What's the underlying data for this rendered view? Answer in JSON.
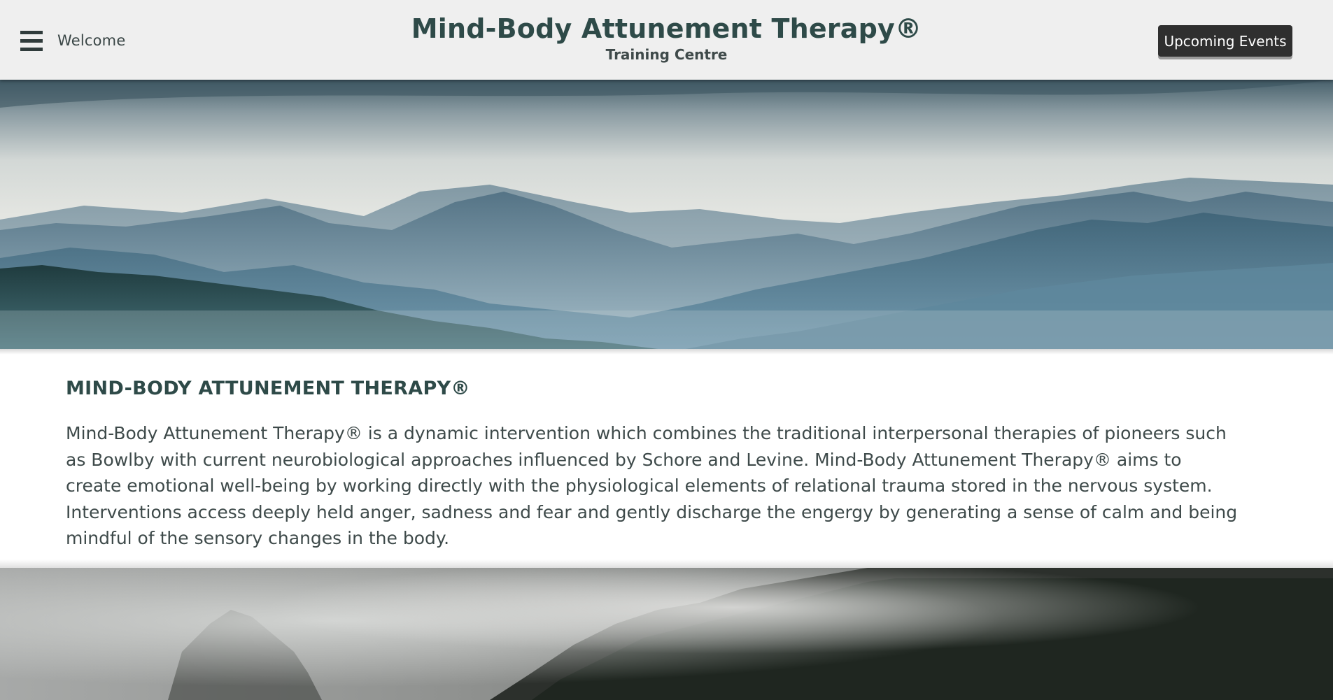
{
  "header": {
    "menu_icon": "hamburger-menu-icon",
    "welcome_label": "Welcome",
    "title": "Mind-Body Attunement Therapy®",
    "subtitle": "Training Centre",
    "events_button_label": "Upcoming Events"
  },
  "hero": {
    "image": "misty-blue-mountains-forest"
  },
  "section": {
    "heading": "MIND-BODY ATTUNEMENT THERAPY®",
    "body": "Mind-Body Attunement Therapy® is a dynamic intervention which combines the traditional interpersonal therapies of pioneers such as Bowlby with current neurobiological approaches influenced by Schore and Levine. Mind-Body Attunement Therapy® aims to create emotional well-being by working directly with the physiological elements of relational trauma stored in the nervous system. Interventions access deeply held anger, sadness and fear and gently discharge the engergy by generating a sense of calm and being mindful of the sensory changes in the body."
  },
  "bottom_image": {
    "image": "foggy-dark-forest-hillside"
  },
  "colors": {
    "header_bg": "#efefef",
    "brand_green": "#2e4a48",
    "body_text": "#3e4a4a",
    "button_bg": "#2f2f2f",
    "button_text": "#ffffff"
  }
}
